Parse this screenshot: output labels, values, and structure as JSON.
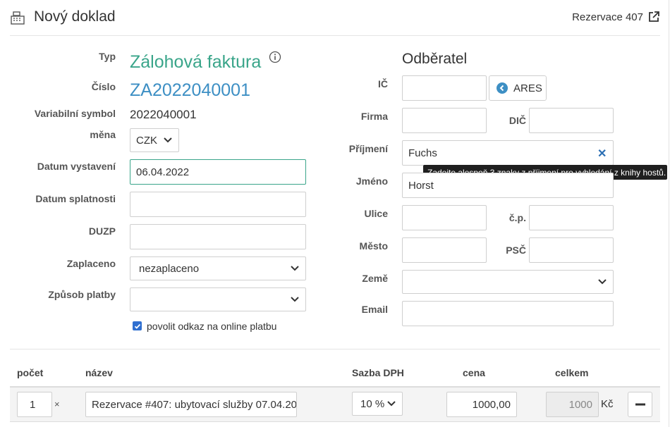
{
  "header": {
    "title": "Nový doklad",
    "link_label": "Rezervace 407"
  },
  "document": {
    "type_label": "Typ",
    "type_value": "Zálohová faktura",
    "number_label": "Číslo",
    "number_value": "ZA2022040001",
    "varsym_label": "Variabilní symbol",
    "varsym_value": "2022040001",
    "currency_label": "měna",
    "currency_value": "CZK",
    "issue_date_label": "Datum vystavení",
    "issue_date_value": "06.04.2022",
    "due_date_label": "Datum splatnosti",
    "due_date_value": "",
    "duzp_label": "DUZP",
    "duzp_value": "",
    "paid_label": "Zaplaceno",
    "paid_value": "nezaplaceno",
    "payment_label": "Způsob platby",
    "payment_value": "",
    "online_checkbox_label": "povolit odkaz na online platbu",
    "online_checkbox_checked": true
  },
  "customer": {
    "title": "Odběratel",
    "ico_label": "IČ",
    "ico_value": "",
    "ares_button": "ARES",
    "company_label": "Firma",
    "company_value": "",
    "dic_label": "DIČ",
    "dic_value": "",
    "surname_label": "Příjmení",
    "surname_value": "Fuchs",
    "surname_tooltip": "Zadejte alespoň 3 znaky z příjmení pro vyhledání z knihy hostů.",
    "name_label": "Jméno",
    "name_value": "Horst",
    "street_label": "Ulice",
    "street_value": "",
    "house_no_label": "č.p.",
    "house_no_value": "",
    "city_label": "Město",
    "city_value": "",
    "zip_label": "PSČ",
    "zip_value": "",
    "country_label": "Země",
    "country_value": "",
    "email_label": "Email",
    "email_value": ""
  },
  "items_table": {
    "columns": [
      "počet",
      "název",
      "Sazba DPH",
      "cena",
      "celkem"
    ],
    "rows": [
      {
        "qty": "1",
        "times": "×",
        "name": "Rezervace #407: ubytovací služby 07.04.20",
        "vat": "10 %",
        "price": "1000,00",
        "total": "1000",
        "currency": "Kč"
      }
    ]
  },
  "colors": {
    "accent_green": "#3aa58a",
    "accent_blue": "#3d8fc4",
    "checkbox_blue": "#2f6fd0"
  }
}
